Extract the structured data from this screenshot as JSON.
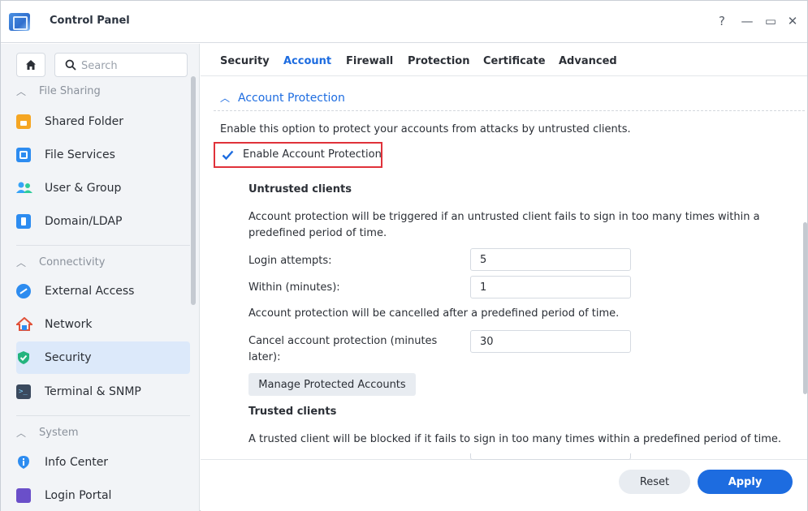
{
  "window": {
    "title": "Control Panel",
    "help": "?",
    "minimize": "—",
    "maximize": "▭",
    "close": "✕"
  },
  "sidebar": {
    "search_placeholder": "Search",
    "sections": [
      {
        "label": "File Sharing",
        "items": [
          {
            "label": "Shared Folder",
            "icon": "shared-folder-icon",
            "color": "#f5a623"
          },
          {
            "label": "File Services",
            "icon": "file-services-icon",
            "color": "#2d8cf0"
          },
          {
            "label": "User & Group",
            "icon": "user-group-icon",
            "color": "#36a3f7"
          },
          {
            "label": "Domain/LDAP",
            "icon": "domain-ldap-icon",
            "color": "#2d8cf0"
          }
        ]
      },
      {
        "label": "Connectivity",
        "items": [
          {
            "label": "External Access",
            "icon": "external-access-icon",
            "color": "#2d8cf0"
          },
          {
            "label": "Network",
            "icon": "network-icon",
            "color": "#e0523a"
          },
          {
            "label": "Security",
            "icon": "security-shield-icon",
            "color": "#24b47e",
            "active": true
          },
          {
            "label": "Terminal & SNMP",
            "icon": "terminal-icon",
            "color": "#3b4a5e"
          }
        ]
      },
      {
        "label": "System",
        "items": [
          {
            "label": "Info Center",
            "icon": "info-center-icon",
            "color": "#2d8cf0"
          },
          {
            "label": "Login Portal",
            "icon": "login-portal-icon",
            "color": "#6a4fc9"
          }
        ]
      }
    ]
  },
  "tabs": [
    "Security",
    "Account",
    "Firewall",
    "Protection",
    "Certificate",
    "Advanced"
  ],
  "active_tab": "Account",
  "content": {
    "section_title": "Account Protection",
    "description": "Enable this option to protect your accounts from attacks by untrusted clients.",
    "enable_checkbox": {
      "label": "Enable Account Protection",
      "checked": true
    },
    "untrusted": {
      "title": "Untrusted clients",
      "description": "Account protection will be triggered if an untrusted client fails to sign in too many times within a predefined period of time.",
      "login_attempts_label": "Login attempts:",
      "login_attempts_value": "5",
      "within_label": "Within (minutes):",
      "within_value": "1",
      "cancel_note": "Account protection will be cancelled after a predefined period of time.",
      "cancel_label": "Cancel account protection (minutes later):",
      "cancel_value": "30",
      "manage_button": "Manage Protected Accounts"
    },
    "trusted": {
      "title": "Trusted clients",
      "description": "A trusted client will be blocked if it fails to sign in too many times within a predefined period of time."
    }
  },
  "footer": {
    "reset": "Reset",
    "apply": "Apply"
  },
  "colors": {
    "accent": "#1d6ce0",
    "highlight_border": "#e0323a",
    "active_nav_bg": "#dce9fa"
  }
}
